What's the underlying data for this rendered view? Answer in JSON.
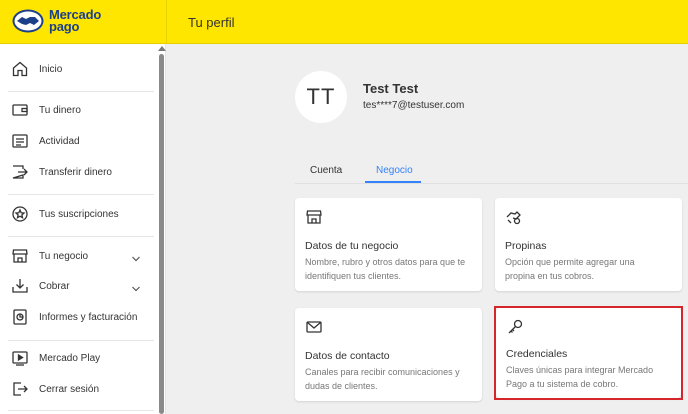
{
  "header": {
    "logo_line1": "Mercado",
    "logo_line2": "pago",
    "title": "Tu perfil",
    "brand_color": "#ffe600"
  },
  "sidebar": {
    "items": [
      {
        "label": "Inicio",
        "icon": "home-icon"
      },
      {
        "label": "Tu dinero",
        "icon": "wallet-icon"
      },
      {
        "label": "Actividad",
        "icon": "activity-icon"
      },
      {
        "label": "Transferir dinero",
        "icon": "transfer-icon"
      },
      {
        "label": "Tus suscripciones",
        "icon": "star-icon"
      },
      {
        "label": "Tu negocio",
        "icon": "store-icon",
        "expandable": true
      },
      {
        "label": "Cobrar",
        "icon": "download-icon",
        "expandable": true
      },
      {
        "label": "Informes y facturación",
        "icon": "report-icon"
      },
      {
        "label": "Mercado Play",
        "icon": "play-icon"
      },
      {
        "label": "Cerrar sesión",
        "icon": "logout-icon"
      }
    ]
  },
  "profile": {
    "initials": "TT",
    "name": "Test Test",
    "email": "tes****7@testuser.com"
  },
  "tabs": [
    {
      "label": "Cuenta",
      "active": false
    },
    {
      "label": "Negocio",
      "active": true
    }
  ],
  "cards": [
    {
      "title": "Datos de tu negocio",
      "desc_line1": "Nombre, rubro y otros datos para que te",
      "desc_line2": "identifiquen tus clientes.",
      "icon": "store-icon"
    },
    {
      "title": "Propinas",
      "desc_line1": "Opción que permite agregar una",
      "desc_line2": "propina en tus cobros.",
      "icon": "tip-hand-icon"
    },
    {
      "title": "Datos de contacto",
      "desc_line1": "Canales para recibir comunicaciones y",
      "desc_line2": "dudas de clientes.",
      "icon": "mail-icon"
    },
    {
      "title": "Credenciales",
      "desc_line1": "Claves únicas para integrar Mercado",
      "desc_line2": "Pago a tu sistema de cobro.",
      "icon": "key-icon",
      "highlighted": true
    }
  ],
  "colors": {
    "accent": "#3483fa",
    "highlight": "#d5262c"
  }
}
